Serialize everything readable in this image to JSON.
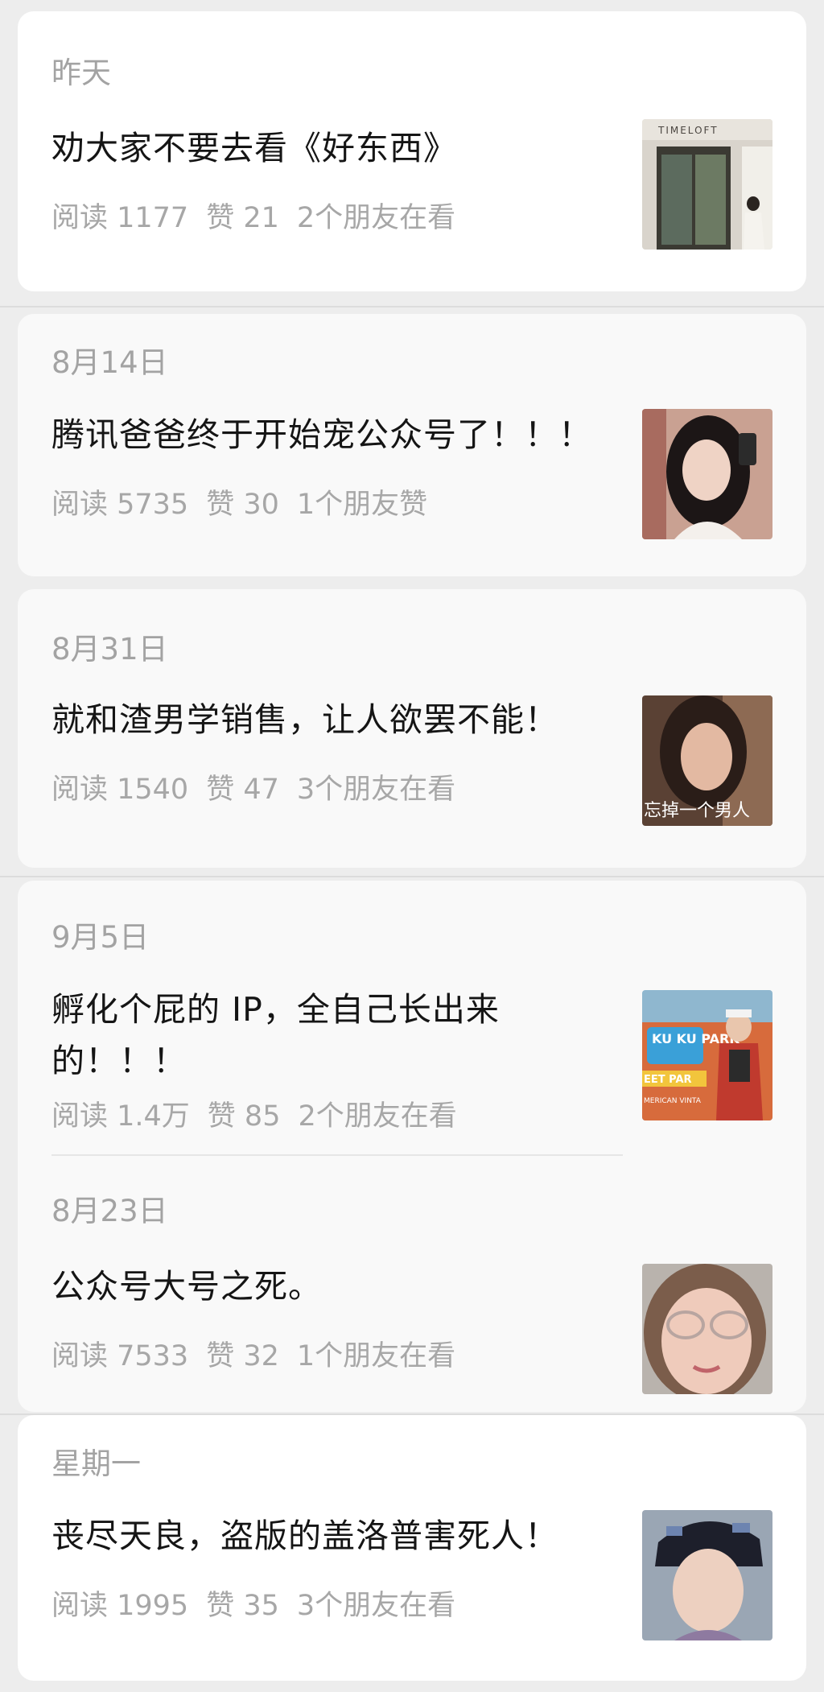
{
  "entries": [
    {
      "date": "昨天",
      "title": "劝大家不要去看《好东西》",
      "reads": "阅读 1177",
      "likes": "赞 21",
      "friends": "2个朋友在看",
      "thumb_icon": "storefront-photo",
      "thumb_text": "TIMELOFT"
    },
    {
      "date": "8月14日",
      "title": "腾讯爸爸终于开始宠公众号了！！！",
      "reads": "阅读 5735",
      "likes": "赞 30",
      "friends": "1个朋友赞",
      "thumb_icon": "selfie-photo"
    },
    {
      "date": "8月31日",
      "title": "就和渣男学销售，让人欲罢不能！",
      "reads": "阅读 1540",
      "likes": "赞 47",
      "friends": "3个朋友在看",
      "thumb_icon": "movie-still-photo",
      "thumb_text": "忘掉一个男人"
    },
    {
      "date": "9月5日",
      "title": "孵化个屁的 IP，全自己长出来的！！！",
      "reads": "阅读 1.4万",
      "likes": "赞 85",
      "friends": "2个朋友在看",
      "thumb_icon": "park-sign-photo",
      "thumb_text": "KU KU PARK",
      "thumb_text2": "EET PAR",
      "thumb_text3": "MERICAN VINTA"
    },
    {
      "date": "8月23日",
      "title": "公众号大号之死。",
      "reads": "阅读 7533",
      "likes": "赞 32",
      "friends": "1个朋友在看",
      "thumb_icon": "glasses-portrait-photo"
    },
    {
      "date": "星期一",
      "title": "丧尽天良，盗版的盖洛普害死人！",
      "reads": "阅读 1995",
      "likes": "赞 35",
      "friends": "3个朋友在看",
      "thumb_icon": "costume-drama-photo"
    }
  ],
  "colors": {
    "background": "#ededed",
    "card": "#ffffff",
    "title": "#151515",
    "meta": "#a7a7a7"
  }
}
